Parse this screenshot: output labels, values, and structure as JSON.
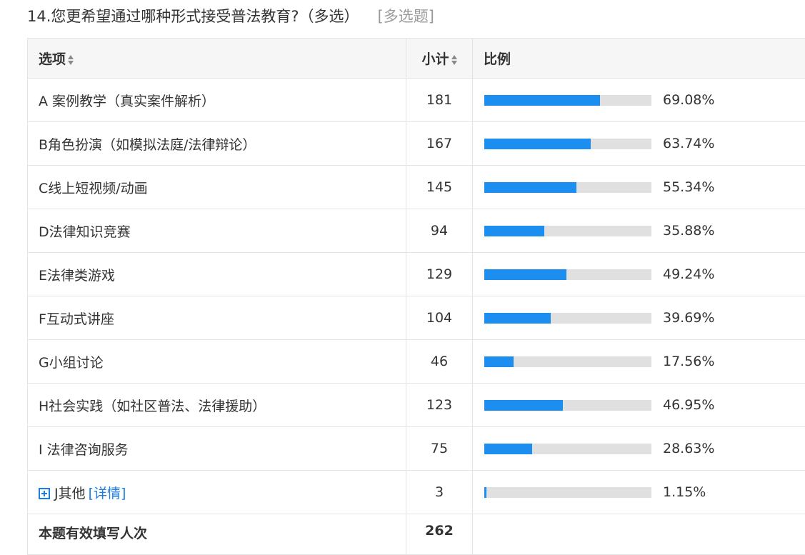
{
  "question": {
    "title": "14.您更希望通过哪种形式接受普法教育?（多选）",
    "type_label": "[多选题]"
  },
  "table": {
    "headers": {
      "option": "选项",
      "count": "小计",
      "ratio": "比例"
    },
    "rows": [
      {
        "option": "A 案例教学（真实案件解析）",
        "count": "181",
        "percent": "69.08%",
        "fraction": 0.6908
      },
      {
        "option": "B角色扮演（如模拟法庭/法律辩论）",
        "count": "167",
        "percent": "63.74%",
        "fraction": 0.6374
      },
      {
        "option": "C线上短视频/动画",
        "count": "145",
        "percent": "55.34%",
        "fraction": 0.5534
      },
      {
        "option": "D法律知识竞赛",
        "count": "94",
        "percent": "35.88%",
        "fraction": 0.3588
      },
      {
        "option": "E法律类游戏",
        "count": "129",
        "percent": "49.24%",
        "fraction": 0.4924
      },
      {
        "option": "F互动式讲座",
        "count": "104",
        "percent": "39.69%",
        "fraction": 0.3969
      },
      {
        "option": "G小组讨论",
        "count": "46",
        "percent": "17.56%",
        "fraction": 0.1756
      },
      {
        "option": "H社会实践（如社区普法、法律援助）",
        "count": "123",
        "percent": "46.95%",
        "fraction": 0.4695
      },
      {
        "option": "I 法律咨询服务",
        "count": "75",
        "percent": "28.63%",
        "fraction": 0.2863
      },
      {
        "option": "J其他",
        "count": "3",
        "percent": "1.15%",
        "fraction": 0.0115,
        "detail_link": "[详情]",
        "expand_icon": "plus-square-icon"
      }
    ],
    "total": {
      "label": "本题有效填写人次",
      "count": "262"
    }
  },
  "colors": {
    "bar_fill": "#1b8ef0",
    "bar_track": "#e0e0e0",
    "link": "#1a7ee6"
  }
}
